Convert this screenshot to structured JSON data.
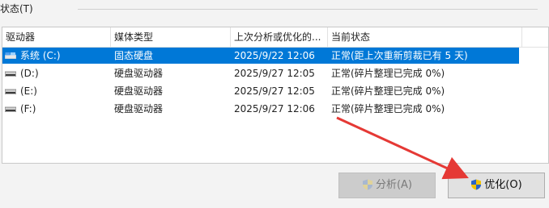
{
  "group": {
    "label": "状态(T)"
  },
  "table": {
    "columns": [
      "驱动器",
      "媒体类型",
      "上次分析或优化的...",
      "当前状态"
    ],
    "rows": [
      {
        "drive": "系统 (C:)",
        "media": "固态硬盘",
        "last": "2025/9/22 12:06",
        "status": "正常(距上次重新剪裁已有 5 天)",
        "icon": "system-drive-icon",
        "selected": true
      },
      {
        "drive": "(D:)",
        "media": "硬盘驱动器",
        "last": "2025/9/27 12:05",
        "status": "正常(碎片整理已完成 0%)",
        "icon": "drive-icon",
        "selected": false
      },
      {
        "drive": "(E:)",
        "media": "硬盘驱动器",
        "last": "2025/9/27 12:05",
        "status": "正常(碎片整理已完成 0%)",
        "icon": "drive-icon",
        "selected": false
      },
      {
        "drive": "(F:)",
        "media": "硬盘驱动器",
        "last": "2025/9/27 12:06",
        "status": "正常(碎片整理已完成 0%)",
        "icon": "drive-icon",
        "selected": false
      }
    ]
  },
  "buttons": {
    "analyze_label": "分析(A)",
    "optimize_label": "优化(O)"
  },
  "colors": {
    "selection": "#0078d7",
    "annotation_arrow": "#e53935"
  }
}
